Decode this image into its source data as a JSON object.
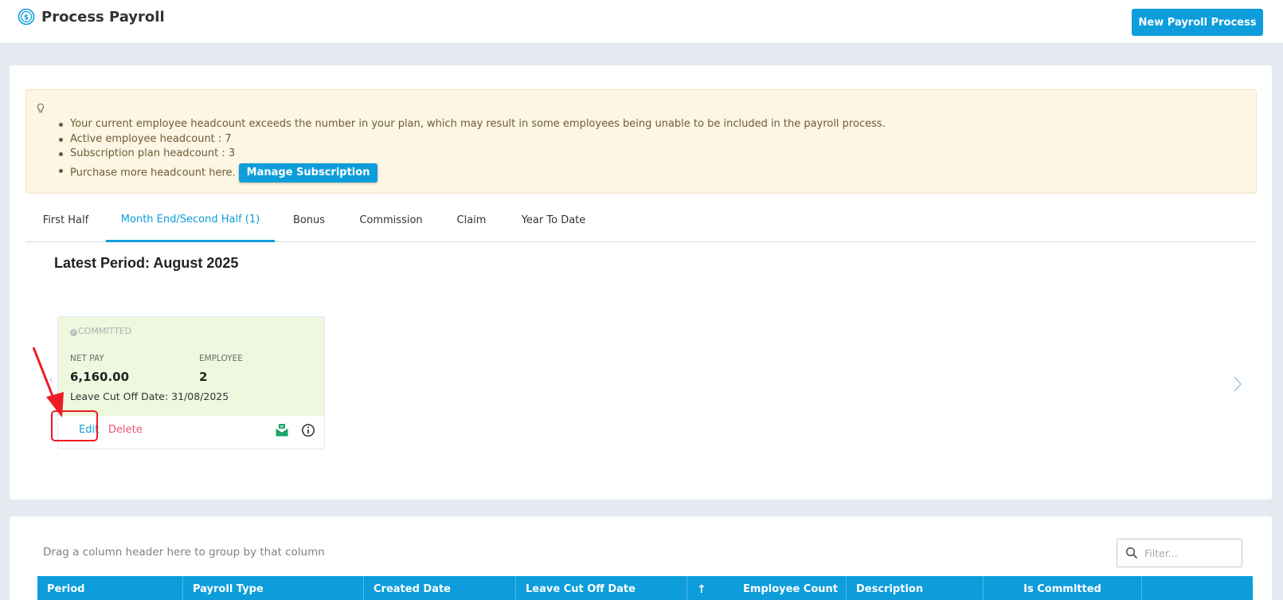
{
  "header": {
    "title": "Process Payroll",
    "new_button": "New Payroll Process"
  },
  "alert": {
    "lines": [
      "Your current employee headcount exceeds the number in your plan, which may result in some employees being unable to be included in the payroll process.",
      "Active employee headcount : 7",
      "Subscription plan headcount : 3",
      "Purchase more headcount here."
    ],
    "manage_button": "Manage Subscription"
  },
  "tabs": [
    {
      "label": "First Half",
      "active": false
    },
    {
      "label": "Month End/Second Half (1)",
      "active": true
    },
    {
      "label": "Bonus",
      "active": false
    },
    {
      "label": "Commission",
      "active": false
    },
    {
      "label": "Claim",
      "active": false
    },
    {
      "label": "Year To Date",
      "active": false
    }
  ],
  "period": {
    "title": "Latest Period: August 2025"
  },
  "card": {
    "status": "COMMITTED",
    "net_pay_label": "NET PAY",
    "net_pay_value": "6,160.00",
    "employee_label": "EMPLOYEE",
    "employee_value": "2",
    "leave_cutoff": "Leave Cut Off Date: 31/08/2025",
    "edit": "Edit",
    "delete": "Delete",
    "icons": [
      "payslip-mail-icon",
      "info-icon"
    ]
  },
  "grid": {
    "group_hint": "Drag a column header here to group by that column",
    "filter_placeholder": "Filter...",
    "columns": [
      "Period",
      "Payroll Type",
      "Created Date",
      "Leave Cut Off Date",
      "Employee Count",
      "Description",
      "Is Committed"
    ]
  },
  "colors": {
    "primary": "#0d9ddb",
    "delete": "#e8556c",
    "alert_bg": "#fdf6e4",
    "card_bg": "#eef8df",
    "annotation": "#ee1c25"
  }
}
